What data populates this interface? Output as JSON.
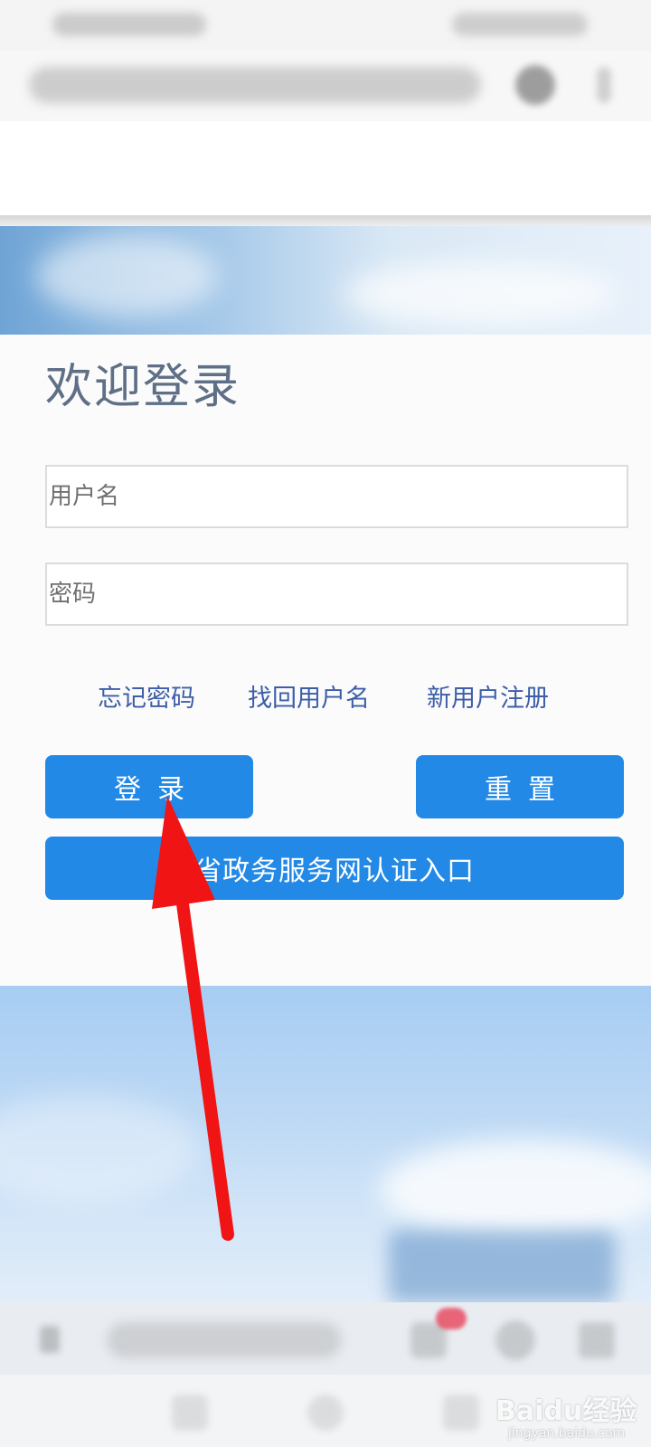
{
  "login": {
    "title": "欢迎登录",
    "username_placeholder": "用户名",
    "password_placeholder": "密码",
    "username_value": "",
    "password_value": ""
  },
  "links": {
    "forgot_password": "忘记密码",
    "find_username": "找回用户名",
    "register": "新用户注册"
  },
  "buttons": {
    "login": "登录",
    "reset": "重置",
    "gov_auth": "省政务服务网认证入口"
  },
  "colors": {
    "accent": "#2389e6",
    "link": "#3d5ea8",
    "title": "#5e6f86",
    "annotation": "#f01414"
  },
  "watermark": {
    "logo": "Baidu经验",
    "domain": "jingyan.baidu.com"
  }
}
